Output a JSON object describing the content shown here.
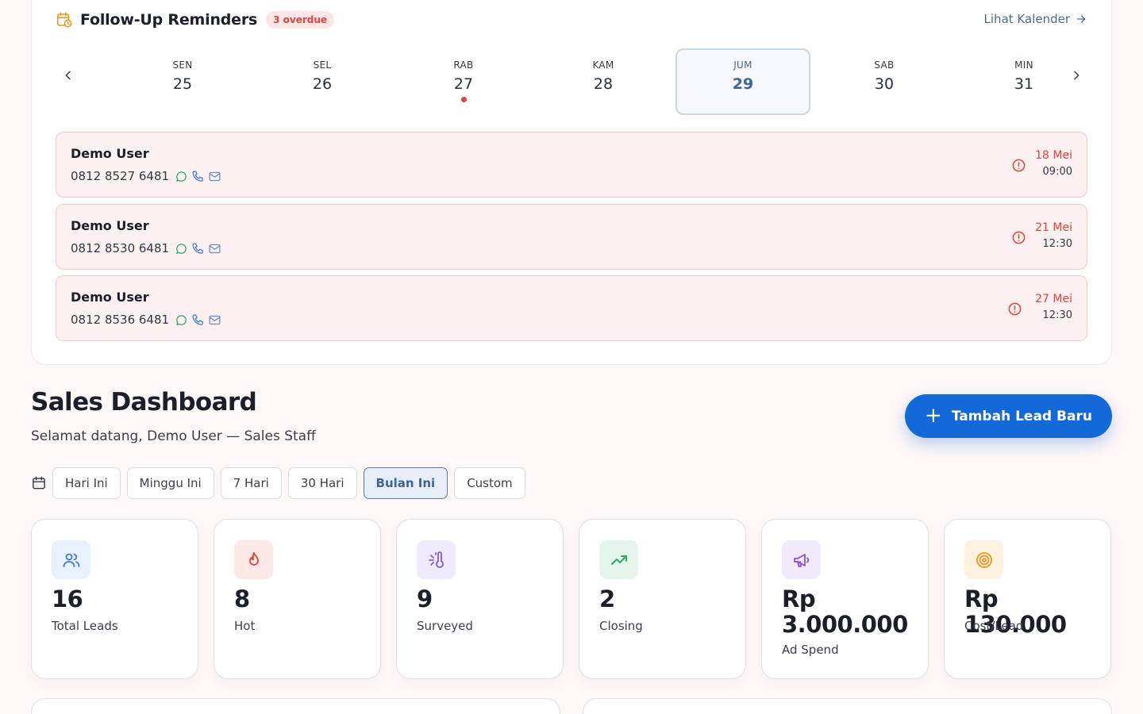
{
  "followup": {
    "title": "Follow-Up Reminders",
    "overdue_badge": "3 overdue",
    "calendar_link": "Lihat Kalender",
    "days": [
      {
        "name": "SEN",
        "num": "25"
      },
      {
        "name": "SEL",
        "num": "26"
      },
      {
        "name": "RAB",
        "num": "27"
      },
      {
        "name": "KAM",
        "num": "28"
      },
      {
        "name": "JUM",
        "num": "29"
      },
      {
        "name": "SAB",
        "num": "30"
      },
      {
        "name": "MIN",
        "num": "31"
      }
    ],
    "reminders": [
      {
        "name": "Demo User",
        "phone": "0812 8527 6481",
        "date": "18 Mei",
        "time": "09:00"
      },
      {
        "name": "Demo User",
        "phone": "0812 8530 6481",
        "date": "21 Mei",
        "time": "12:30"
      },
      {
        "name": "Demo User",
        "phone": "0812 8536 6481",
        "date": "27 Mei",
        "time": "12:30"
      }
    ]
  },
  "dashboard": {
    "title": "Sales Dashboard",
    "subtitle": "Selamat datang, Demo User — Sales Staff",
    "add_button": "Tambah Lead Baru",
    "filters": [
      "Hari Ini",
      "Minggu Ini",
      "7 Hari",
      "30 Hari",
      "Bulan Ini",
      "Custom"
    ],
    "active_filter": "Bulan Ini"
  },
  "stats": [
    {
      "value": "16",
      "label": "Total Leads",
      "icon": "users-icon",
      "color": "#3d7bd6",
      "bg": "#e8f1fd"
    },
    {
      "value": "8",
      "label": "Hot",
      "icon": "flame-icon",
      "color": "#e0443a",
      "bg": "#fde8e8"
    },
    {
      "value": "9",
      "label": "Surveyed",
      "icon": "thermometer-icon",
      "color": "#7b5ce0",
      "bg": "#efeafd"
    },
    {
      "value": "2",
      "label": "Closing",
      "icon": "trending-up-icon",
      "color": "#2fa866",
      "bg": "#e4f6ec"
    },
    {
      "value": "Rp 3.000.000",
      "label": "Ad Spend",
      "icon": "megaphone-icon",
      "color": "#8a4fd8",
      "bg": "#f1e9fc"
    },
    {
      "value": "Rp 130.000",
      "label": "Cost/Lead",
      "icon": "target-icon",
      "color": "#e8951f",
      "bg": "#fdf1df"
    }
  ]
}
